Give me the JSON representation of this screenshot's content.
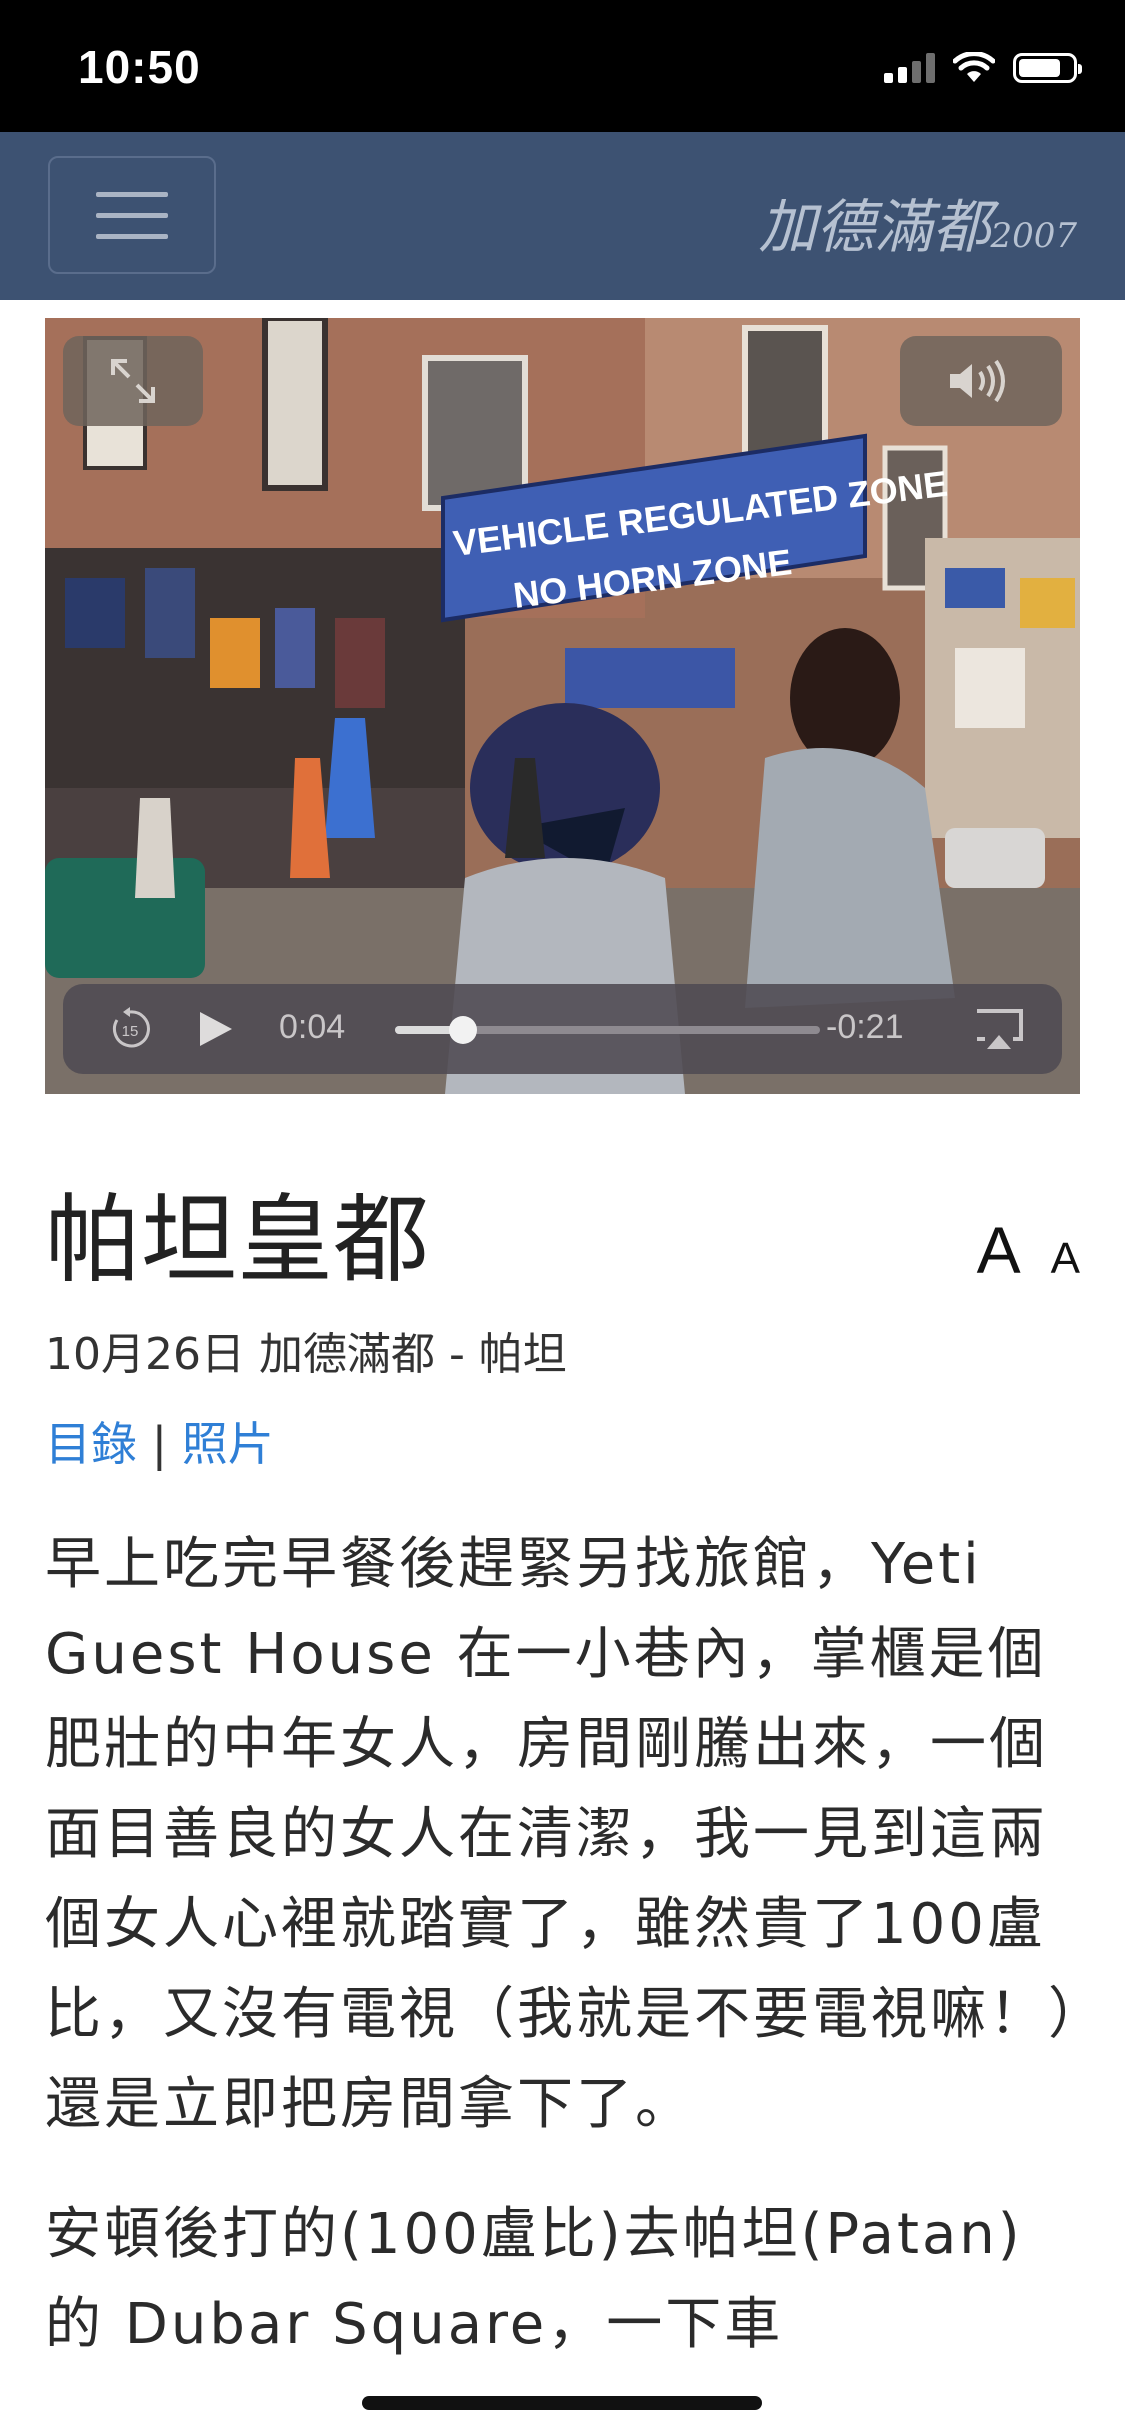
{
  "status_bar": {
    "time": "10:50"
  },
  "navbar": {
    "menu_icon": "hamburger-menu-icon",
    "brand": "加德滿都",
    "brand_year": "2007"
  },
  "video": {
    "banner_line1": "VEHICLE REGULATED ZONE",
    "banner_line2": "NO HORN ZONE",
    "elapsed": "0:04",
    "remaining": "-0:21",
    "progress": 0.16,
    "icons": [
      "expand-icon",
      "volume-icon",
      "rewind-15-icon",
      "play-icon",
      "airplay-icon"
    ]
  },
  "article": {
    "title": "帕坦皇都",
    "font_larger": "A",
    "font_smaller": "A",
    "meta": "10月26日 加德滿都 - 帕坦",
    "link_toc": "目錄",
    "separator": "|",
    "link_photos": "照片",
    "paragraphs": [
      "早上吃完早餐後趕緊另找旅館，Yeti Guest House 在一小巷內，掌櫃是個肥壯的中年女人，房間剛騰出來，一個面目善良的女人在清潔，我一見到這兩個女人心裡就踏實了，雖然貴了100盧比，又沒有電視（我就是不要電視嘛！）還是立即把房間拿下了。",
      "安頓後打的(100盧比)去帕坦(Patan) 的 Dubar Square，一下車"
    ]
  }
}
